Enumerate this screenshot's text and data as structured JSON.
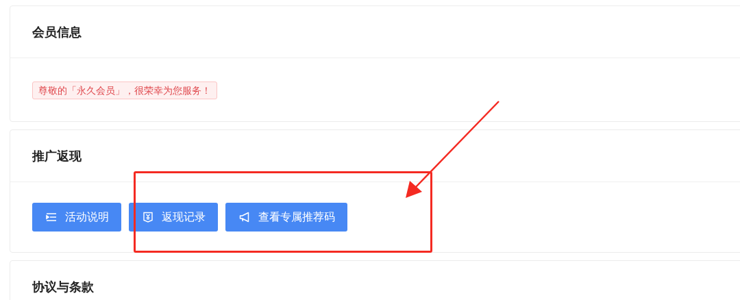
{
  "sections": [
    {
      "kind": "member",
      "title": "会员信息",
      "tag": "尊敬的「永久会员」，很荣幸为您服务！"
    },
    {
      "kind": "actions",
      "title": "推广返现",
      "buttons": [
        {
          "kind": "list",
          "label": "活动说明"
        },
        {
          "kind": "voucher",
          "label": "返现记录"
        },
        {
          "kind": "megaphone",
          "label": "查看专属推荐码"
        }
      ]
    },
    {
      "kind": "plain",
      "title": "协议与条款"
    }
  ]
}
